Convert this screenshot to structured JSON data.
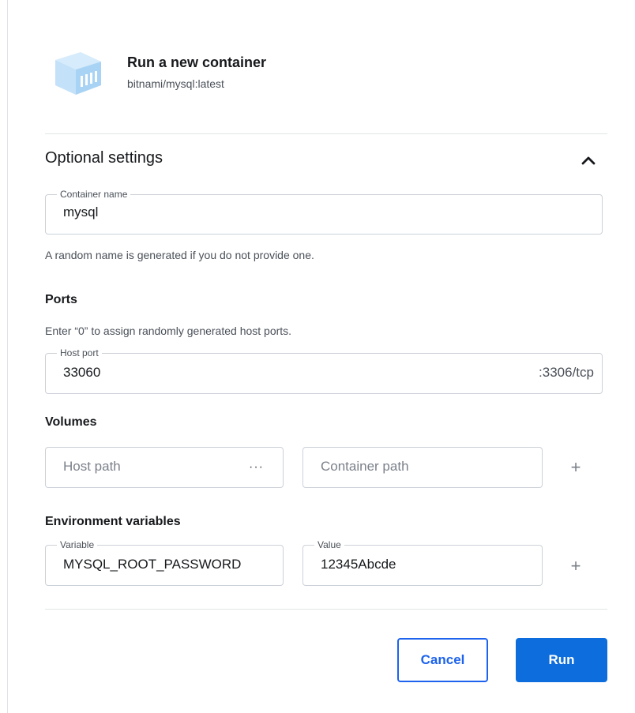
{
  "header": {
    "icon": "container-cube-icon",
    "title": "Run a new container",
    "subtitle": "bitnami/mysql:latest"
  },
  "optional_settings": {
    "title": "Optional settings",
    "expanded": true,
    "toggle_icon": "chevron-up-icon"
  },
  "container_name": {
    "label": "Container name",
    "value": "mysql",
    "helper": "A random name is generated if you do not provide one."
  },
  "ports": {
    "title": "Ports",
    "helper": "Enter “0” to assign randomly generated host ports.",
    "host_port_label": "Host port",
    "host_port_value": "33060",
    "container_port": ":3306/tcp"
  },
  "volumes": {
    "title": "Volumes",
    "host_path_placeholder": "Host path",
    "browse_label": "···",
    "container_path_placeholder": "Container path",
    "add_icon": "plus-icon"
  },
  "env": {
    "title": "Environment variables",
    "variable_label": "Variable",
    "variable_value": "MYSQL_ROOT_PASSWORD",
    "value_label": "Value",
    "value_value": "12345Abcde",
    "add_icon": "plus-icon"
  },
  "actions": {
    "cancel_label": "Cancel",
    "run_label": "Run"
  },
  "colors": {
    "primary": "#0d6ddc",
    "primary_outline": "#1d63ed",
    "cube": "#b9dcf6"
  }
}
